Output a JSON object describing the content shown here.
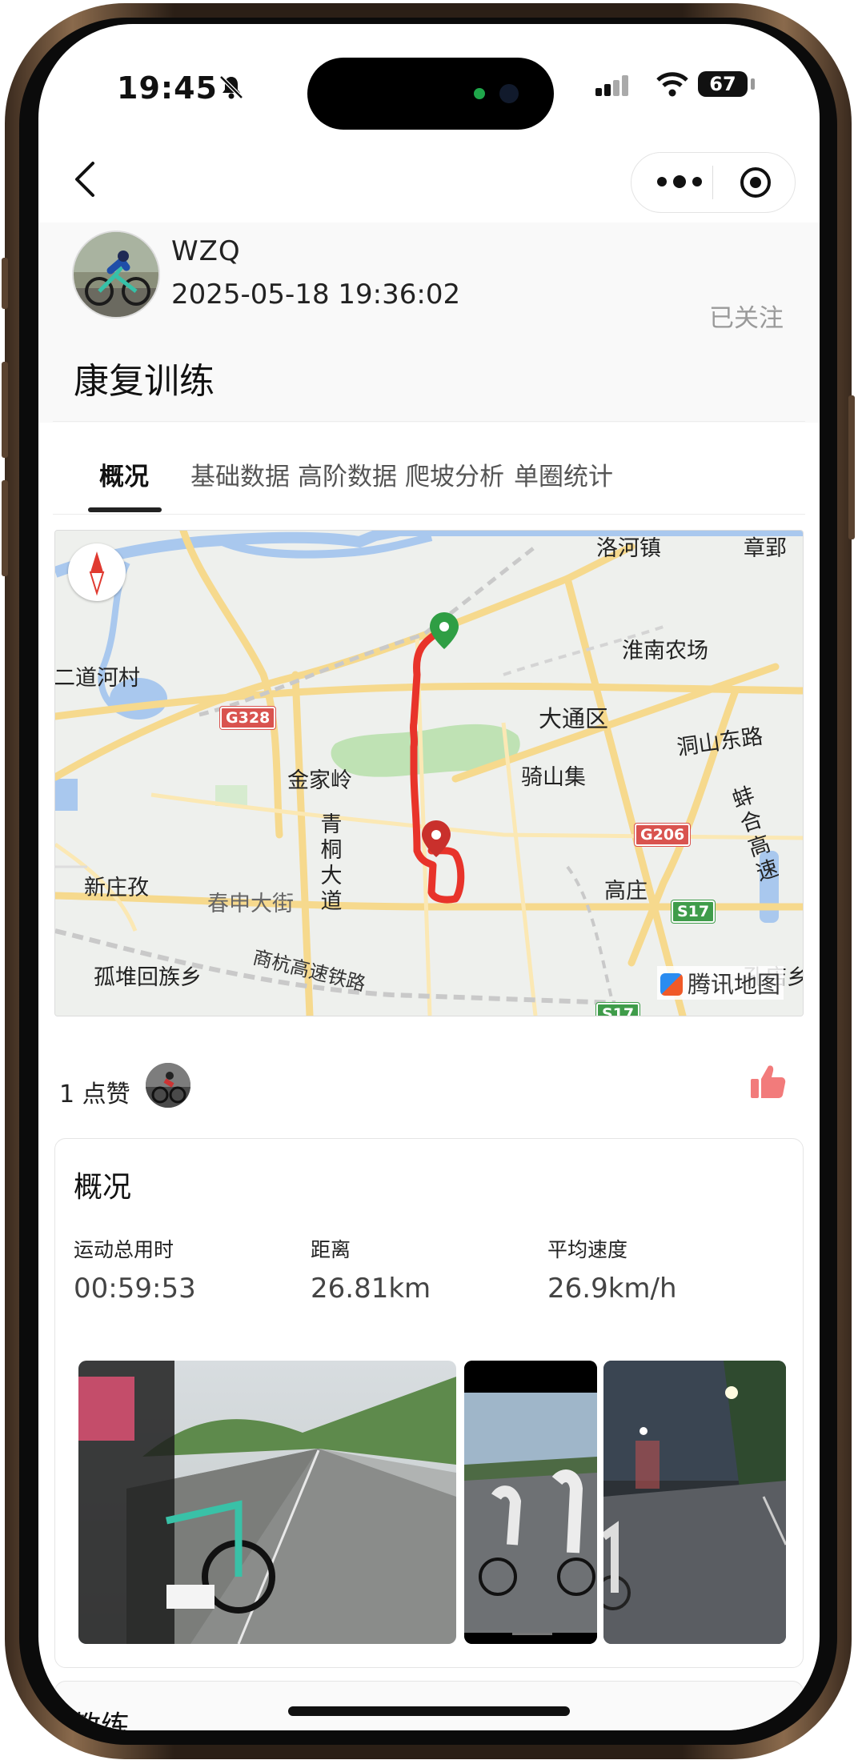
{
  "status_bar": {
    "time": "19:45",
    "battery": "67",
    "icons": [
      "bell-slash-icon",
      "signal-icon",
      "wifi-icon",
      "battery-icon"
    ]
  },
  "nav": {
    "icons": [
      "back-chevron-icon",
      "more-dots-icon",
      "target-icon"
    ]
  },
  "header": {
    "username": "WZQ",
    "timestamp": "2025-05-18 19:36:02",
    "follow_label": "已关注",
    "activity_title": "康复训练"
  },
  "tabs": [
    {
      "label": "概况",
      "active": true
    },
    {
      "label": "基础数据",
      "active": false
    },
    {
      "label": "高阶数据",
      "active": false
    },
    {
      "label": "爬坡分析",
      "active": false
    },
    {
      "label": "单圈统计",
      "active": false
    }
  ],
  "map": {
    "labels": {
      "luohe": "洛河镇",
      "zhang": "章郢",
      "erdao": "二道河村",
      "huainan_farm": "淮南农场",
      "datong": "大通区",
      "dongshan": "洞山东路",
      "jinjialing": "金家岭",
      "qishanji": "骑山集",
      "qingtong": "青桐大道",
      "bengfu": "蚌合高速",
      "xinzhuang": "新庄孜",
      "chunshen": "春申大街",
      "gaozhuang": "高庄",
      "guidui": "孤堆回族乡",
      "shanghang": "商杭高速铁路",
      "kongdian": "孔店乡"
    },
    "shields": {
      "g328": "G328",
      "g206": "G206",
      "s17": "S17",
      "s17b": "S17"
    },
    "logo": "腾讯地图",
    "route_color": "#e8332a",
    "start_marker_color": "#2f9e44",
    "end_marker_color": "#c9302c"
  },
  "likes": {
    "count_label": "1 点赞"
  },
  "overview": {
    "title": "概况",
    "stats": [
      {
        "label": "运动总用时",
        "value": "00:59:53"
      },
      {
        "label": "距离",
        "value": "26.81km"
      },
      {
        "label": "平均速度",
        "value": "26.9km/h"
      }
    ]
  },
  "next_section": {
    "title": "教练"
  }
}
